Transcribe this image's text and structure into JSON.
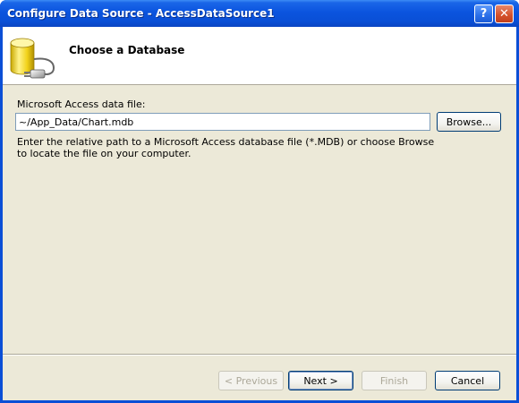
{
  "window": {
    "title": "Configure Data Source - AccessDataSource1",
    "help_button": "?",
    "close_button": "✕"
  },
  "header": {
    "title": "Choose a Database",
    "icon": "database-connector-icon"
  },
  "form": {
    "file_label": "Microsoft Access data file:",
    "file_value": "~/App_Data/Chart.mdb",
    "browse_label": "Browse...",
    "help_text": "Enter the relative path to a Microsoft Access database file (*.MDB) or choose Browse to locate the file on your computer."
  },
  "footer": {
    "previous_label": "< Previous",
    "next_label": "Next >",
    "finish_label": "Finish",
    "cancel_label": "Cancel"
  },
  "colors": {
    "titlebar": "#0a4fd6",
    "dialog_bg": "#ece9d8",
    "header_bg": "#ffffff"
  }
}
